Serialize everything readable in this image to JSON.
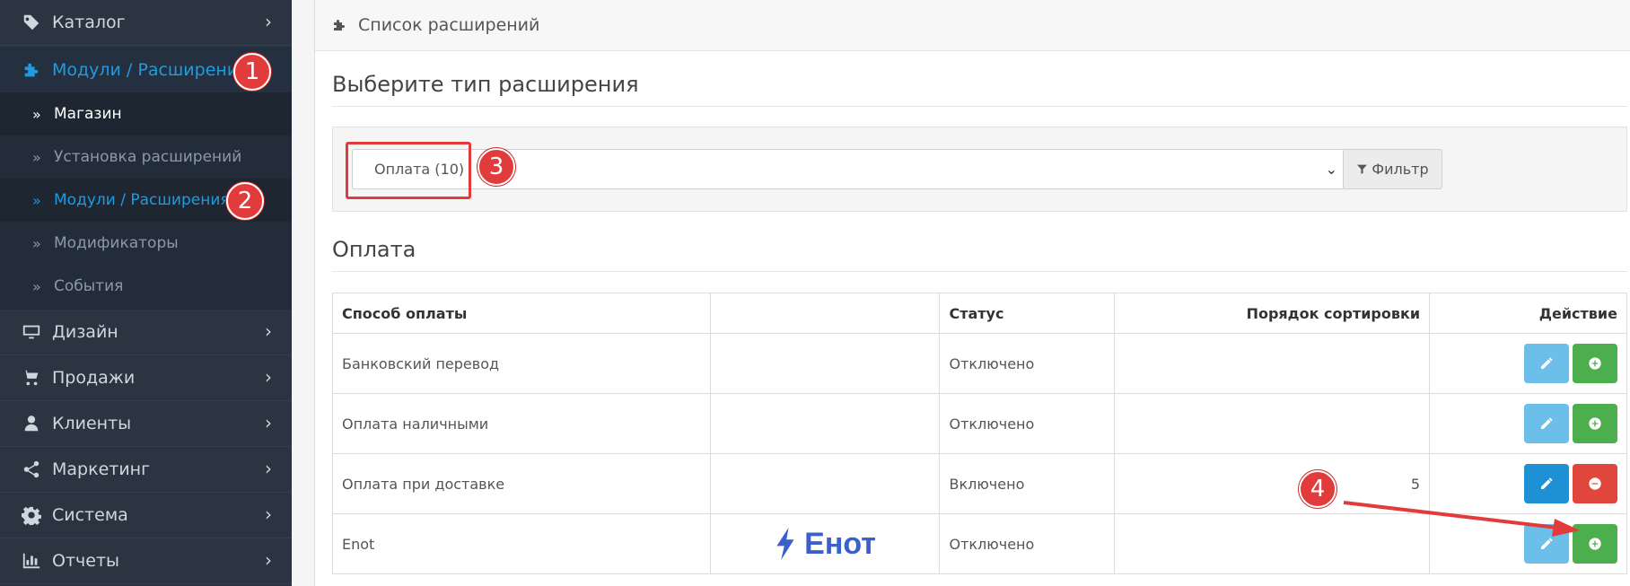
{
  "sidebar": {
    "items": [
      {
        "label": "Каталог",
        "icon": "tags-icon"
      },
      {
        "label": "Модули / Расширения",
        "icon": "puzzle-icon"
      },
      {
        "label": "Дизайн",
        "icon": "desktop-icon"
      },
      {
        "label": "Продажи",
        "icon": "cart-icon"
      },
      {
        "label": "Клиенты",
        "icon": "user-icon"
      },
      {
        "label": "Маркетинг",
        "icon": "share-icon"
      },
      {
        "label": "Система",
        "icon": "gear-icon"
      },
      {
        "label": "Отчеты",
        "icon": "bar-chart-icon"
      }
    ],
    "sub_items": [
      {
        "label": "Магазин"
      },
      {
        "label": "Установка расширений"
      },
      {
        "label": "Модули / Расширения"
      },
      {
        "label": "Модификаторы"
      },
      {
        "label": "События"
      }
    ],
    "accent_color": "#1f9bde"
  },
  "badges": {
    "one": "1",
    "two": "2",
    "three": "3",
    "four": "4"
  },
  "panel": {
    "title": "Список расширений",
    "choose_heading": "Выберите тип расширения",
    "select_value": "Оплата (10)",
    "filter_label": "Фильтр",
    "section_heading": "Оплата"
  },
  "table": {
    "headers": [
      "Способ оплаты",
      "",
      "Статус",
      "Порядок сортировки",
      "Действие"
    ],
    "rows": [
      {
        "name": "Банковский перевод",
        "status": "Отключено",
        "sort": ""
      },
      {
        "name": "Оплата наличными",
        "status": "Отключено",
        "sort": ""
      },
      {
        "name": "Оплата при доставке",
        "status": "Включено",
        "sort": "5"
      },
      {
        "name": "Enot",
        "status": "Отключено",
        "sort": "",
        "logo_text": "Енот"
      }
    ]
  }
}
